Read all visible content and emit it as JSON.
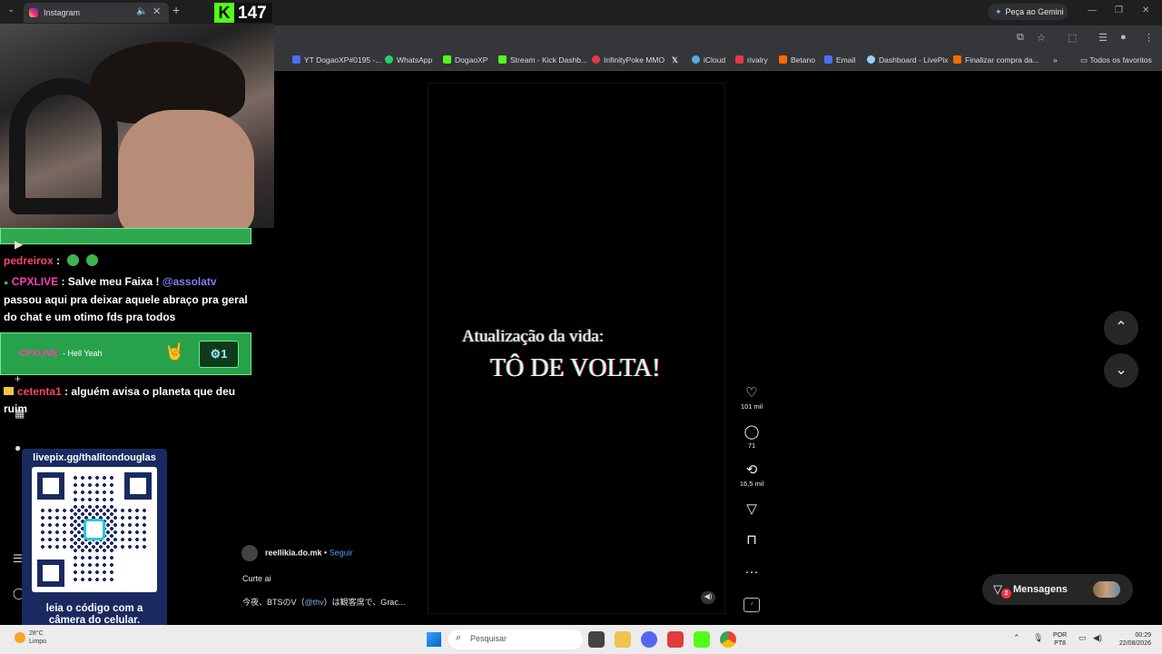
{
  "browser": {
    "active_tab": "Instagram",
    "gemini_label": "Peça ao Gemini",
    "bookmarks": [
      {
        "label": "YT DogaoXP#0195 -...",
        "color": "#4c6ef5"
      },
      {
        "label": "WhatsApp",
        "color": "#25d366"
      },
      {
        "label": "DogaoXP",
        "color": "#53fc18"
      },
      {
        "label": "Stream - Kick Dashb...",
        "color": "#53fc18"
      },
      {
        "label": "InfinityPoke MMO",
        "color": "#e63946"
      },
      {
        "label": "",
        "color": "#000000"
      },
      {
        "label": "iCloud",
        "color": "#5aa9e6"
      },
      {
        "label": "rivalry",
        "color": "#e63946"
      },
      {
        "label": "Betano",
        "color": "#ff6a00"
      },
      {
        "label": "Email",
        "color": "#4c6ef5"
      },
      {
        "label": "Dashboard - LivePix",
        "color": "#9ad0ff"
      },
      {
        "label": "Finalizar compra da...",
        "color": "#ff6a00"
      }
    ],
    "all_bookmarks": "Todos os favoritos"
  },
  "stream": {
    "viewer_count": "147",
    "chat": {
      "line1_user": "pedreirox",
      "line2_user": "CPXLIVE",
      "line2_text": "Salve meu Faixa !",
      "line2_mention": "@assolatv",
      "line2_cont1": "passou aqui pra deixar aquele abraço pra geral",
      "line2_cont2": "do chat e um otimo fds pra todos",
      "highlight_user": "CPXLIVE",
      "highlight_msg": "- Hell Yeah",
      "highlight_count": "1",
      "line3_user": "cetenta1",
      "line3_text": "alguém avisa o planeta que deu",
      "line3_cont": "ruim"
    },
    "qr": {
      "url": "livepix.gg/thalitondouglas",
      "hint1": "leia o código com a",
      "hint2": "câmera do celular."
    }
  },
  "reel": {
    "text_line1": "Atualização da vida:",
    "text_line2": "TÔ DE VOLTA!",
    "likes": "101 mil",
    "comments": "71",
    "reposts": "16,5 mil",
    "author": "reellikia.do.mk",
    "follow": "Seguir",
    "caption1": "Curte ai",
    "caption2_pre": "今夜、BTSのV（",
    "caption2_mention": "@thv",
    "caption2_post": "）は観客席で、Grac..."
  },
  "messages": {
    "label": "Mensagens",
    "badge": "2"
  },
  "taskbar": {
    "weather_temp": "28°C",
    "weather_desc": "Limpo",
    "search_placeholder": "Pesquisar",
    "lang1": "POR",
    "lang2": "PT8",
    "time": "00:29",
    "date": "22/08/2026"
  }
}
